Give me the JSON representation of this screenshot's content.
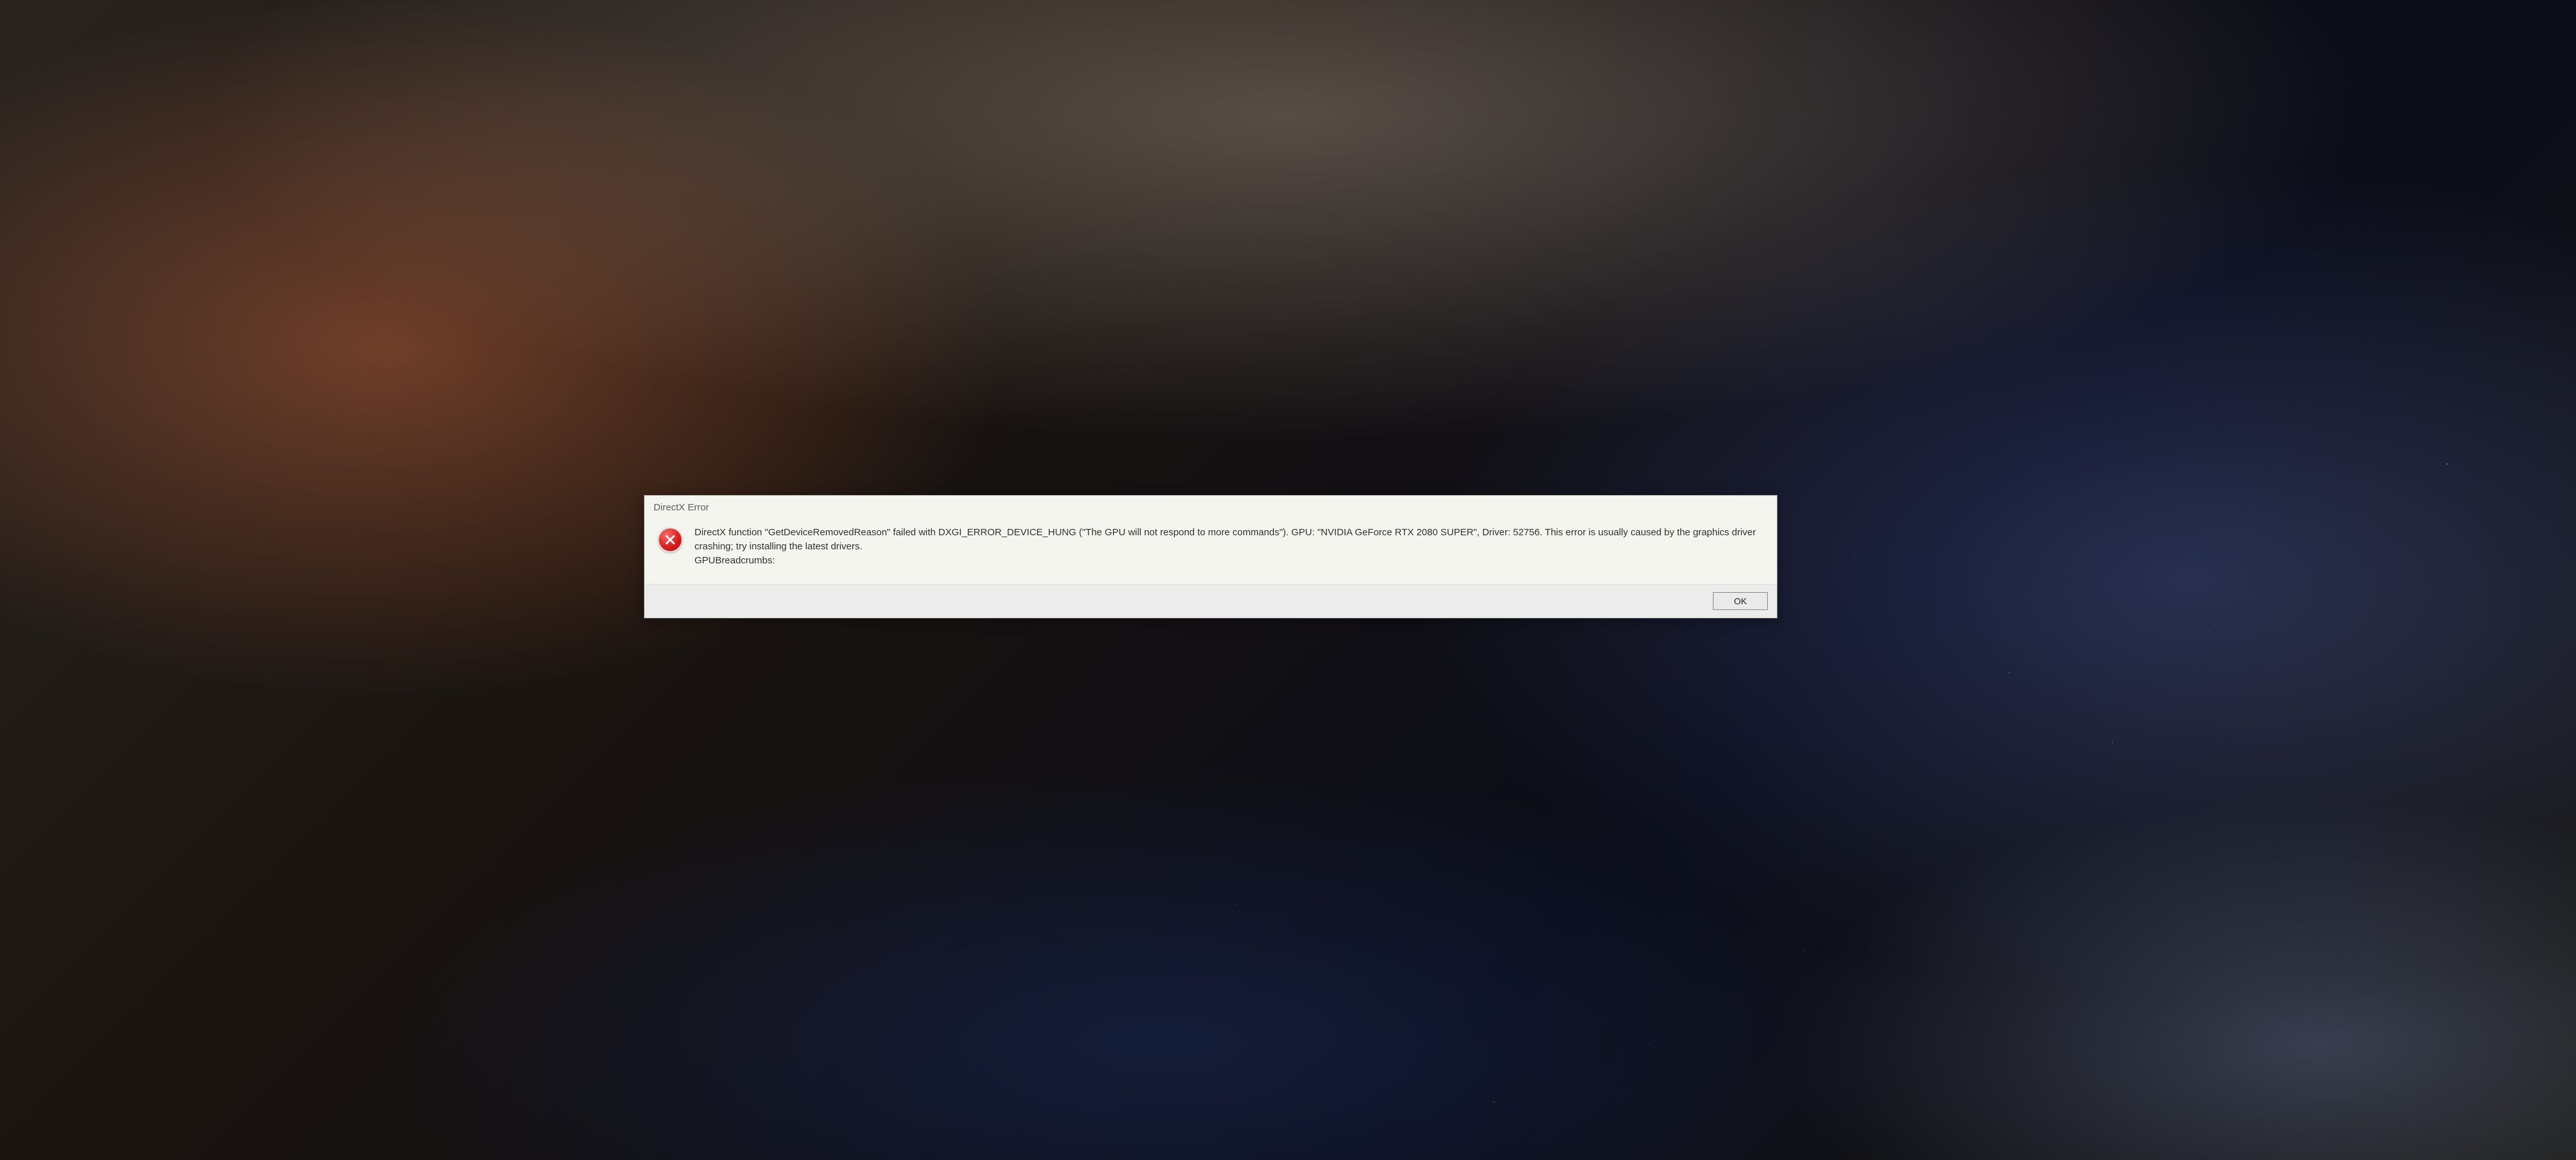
{
  "dialog": {
    "title": "DirectX Error",
    "icon": "error-icon",
    "message": "DirectX function \"GetDeviceRemovedReason\" failed with DXGI_ERROR_DEVICE_HUNG (\"The GPU will not respond to more commands\"). GPU: \"NVIDIA GeForce RTX 2080 SUPER\", Driver: 52756. This error is usually caused by the graphics driver crashing; try installing the latest drivers.\nGPUBreadcrumbs:",
    "ok_label": "OK"
  }
}
